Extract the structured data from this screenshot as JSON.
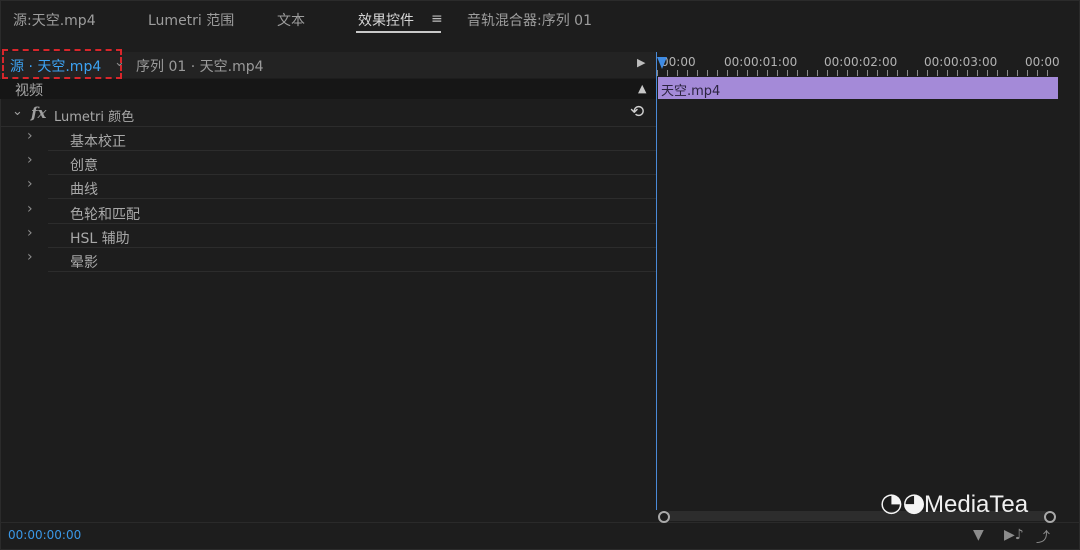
{
  "tabs": [
    {
      "label": "源:天空.mp4"
    },
    {
      "label": "Lumetri 范围"
    },
    {
      "label": "文本"
    },
    {
      "label": "效果控件"
    },
    {
      "label": "音轨混合器:序列 01"
    }
  ],
  "active_tab": "效果控件",
  "clip_bar": {
    "source_clip": "源 · 天空.mp4",
    "sequence_clip": "序列 01 · 天空.mp4"
  },
  "section": {
    "label": "视频"
  },
  "effect": {
    "label": "Lumetri 颜色"
  },
  "properties": [
    {
      "label": "基本校正"
    },
    {
      "label": "创意"
    },
    {
      "label": "曲线"
    },
    {
      "label": "色轮和匹配"
    },
    {
      "label": "HSL 辅助"
    },
    {
      "label": "晕影"
    }
  ],
  "timecode": "00:00:00:00",
  "ruler": {
    "labels": [
      "00:00",
      "00:00:01:00",
      "00:00:02:00",
      "00:00:03:00",
      "00:00"
    ]
  },
  "timeline_clip": {
    "label": "天空.mp4",
    "color": "#a48ad8"
  },
  "watermark": {
    "text": "MediaTea"
  },
  "colors": {
    "accent": "#3ca2f2",
    "highlight": "#d8262b"
  }
}
